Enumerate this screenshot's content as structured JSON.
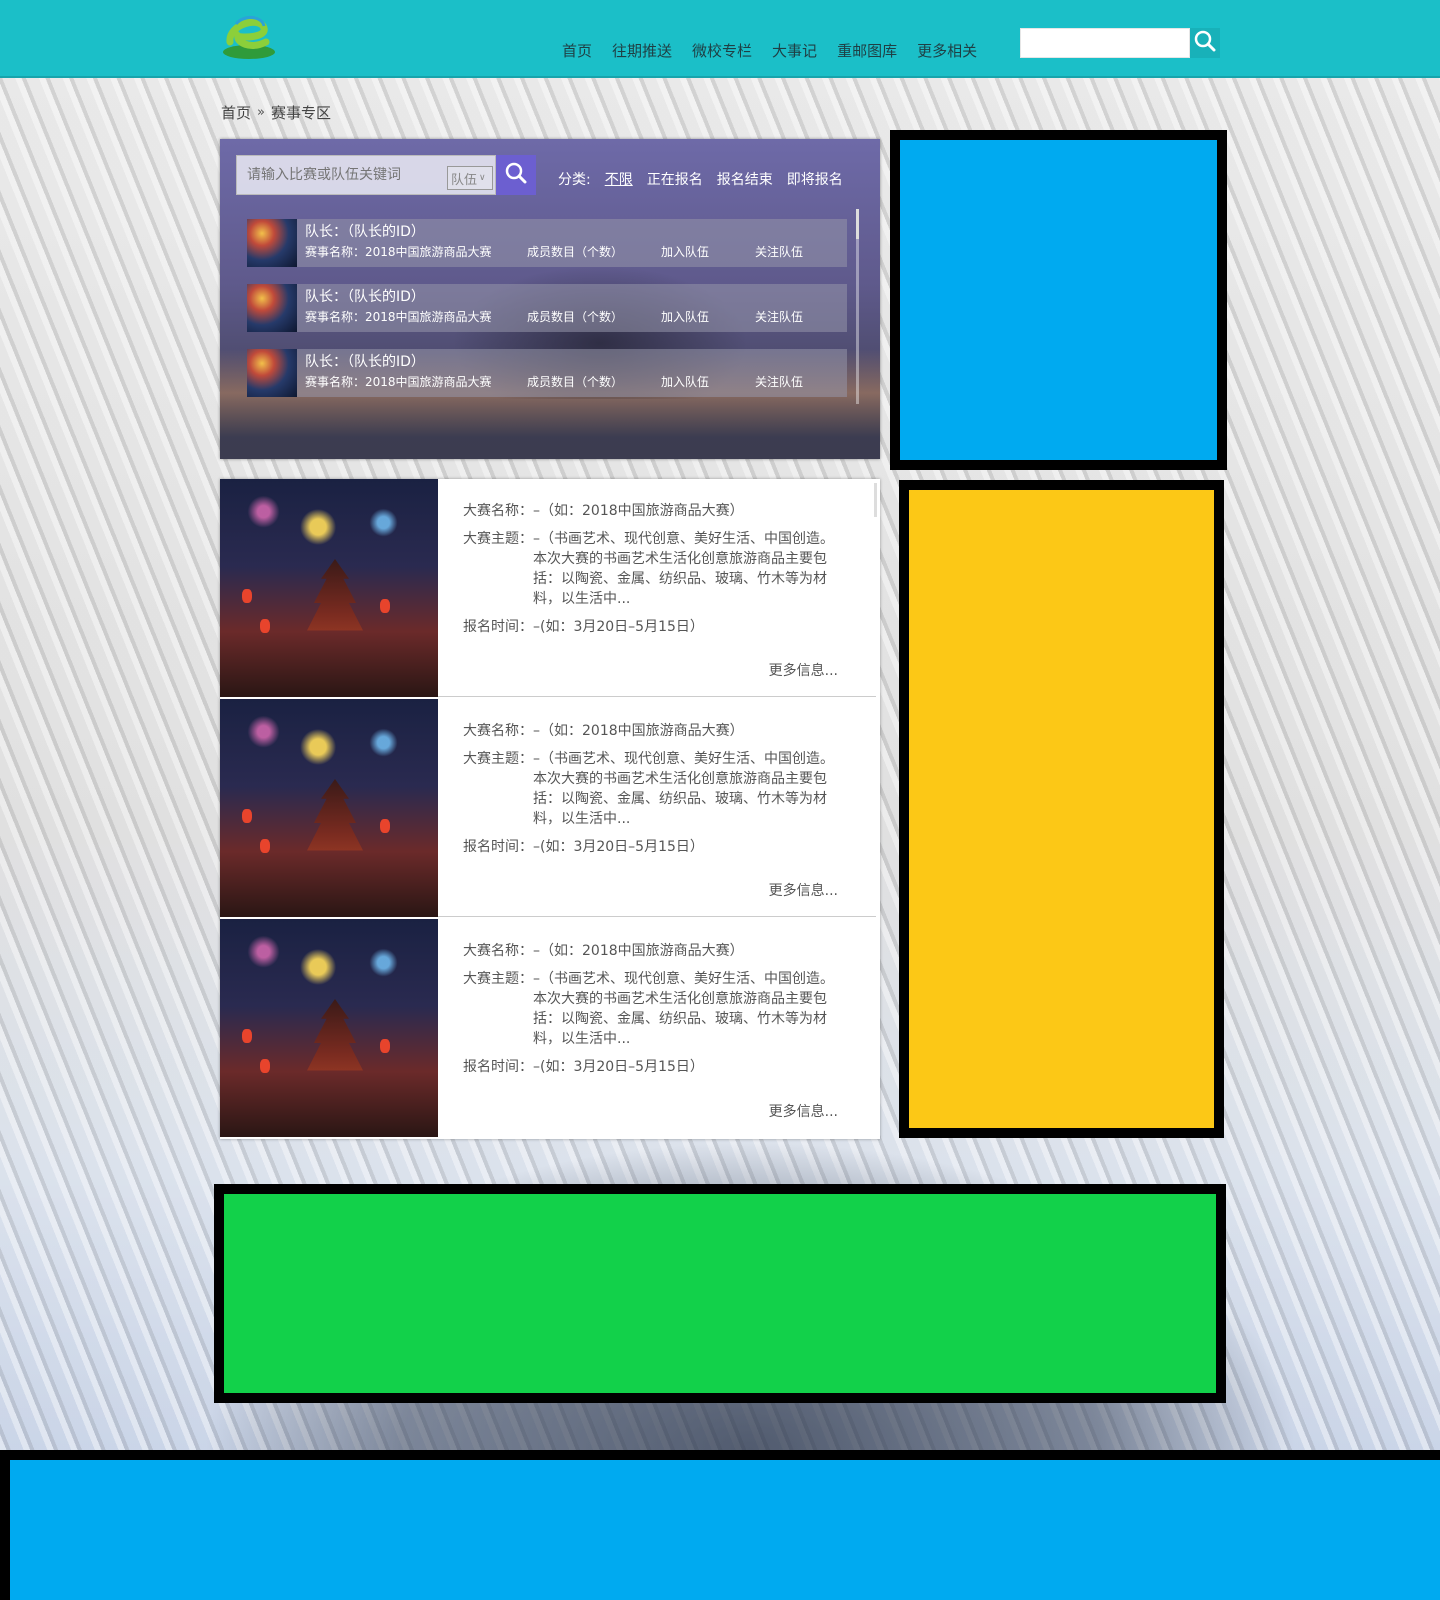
{
  "header": {
    "nav": [
      "首页",
      "往期推送",
      "微校专栏",
      "大事记",
      "重邮图库",
      "更多相关"
    ],
    "search_placeholder": ""
  },
  "breadcrumb": {
    "home": "首页",
    "separator": "»",
    "current": "赛事专区"
  },
  "team_panel": {
    "search_placeholder": "请输入比赛或队伍关键词",
    "select_value": "队伍",
    "filter_label": "分类:",
    "filters": [
      "不限",
      "正在报名",
      "报名结束",
      "即将报名"
    ],
    "active_filter": "不限",
    "teams": [
      {
        "captain": "队长：（队长的ID）",
        "contest": "赛事名称：2018中国旅游商品大赛",
        "members": "成员数目（个数）",
        "join": "加入队伍",
        "follow": "关注队伍"
      },
      {
        "captain": "队长：（队长的ID）",
        "contest": "赛事名称：2018中国旅游商品大赛",
        "members": "成员数目（个数）",
        "join": "加入队伍",
        "follow": "关注队伍"
      },
      {
        "captain": "队长：（队长的ID）",
        "contest": "赛事名称：2018中国旅游商品大赛",
        "members": "成员数目（个数）",
        "join": "加入队伍",
        "follow": "关注队伍"
      }
    ]
  },
  "contests": [
    {
      "name_label": "大赛名称：",
      "name": "–（如：2018中国旅游商品大赛）",
      "theme_label": "大赛主题：",
      "theme": "–（书画艺术、现代创意、美好生活、中国创造。本次大赛的书画艺术生活化创意旅游商品主要包括：以陶瓷、金属、纺织品、玻璃、竹木等为材料，以生活中...",
      "time_label": "报名时间：",
      "time": "–(如：3月20日–5月15日）",
      "more": "更多信息..."
    },
    {
      "name_label": "大赛名称：",
      "name": "–（如：2018中国旅游商品大赛）",
      "theme_label": "大赛主题：",
      "theme": "–（书画艺术、现代创意、美好生活、中国创造。本次大赛的书画艺术生活化创意旅游商品主要包括：以陶瓷、金属、纺织品、玻璃、竹木等为材料，以生活中...",
      "time_label": "报名时间：",
      "time": "–(如：3月20日–5月15日）",
      "more": "更多信息..."
    },
    {
      "name_label": "大赛名称：",
      "name": "–（如：2018中国旅游商品大赛）",
      "theme_label": "大赛主题：",
      "theme": "–（书画艺术、现代创意、美好生活、中国创造。本次大赛的书画艺术生活化创意旅游商品主要包括：以陶瓷、金属、纺织品、玻璃、竹木等为材料，以生活中...",
      "time_label": "报名时间：",
      "time": "–(如：3月20日–5月15日）",
      "more": "更多信息..."
    }
  ],
  "colors": {
    "header": "#1bbfc8",
    "block_blue": "#00aaf0",
    "block_yellow": "#fcc816",
    "block_green": "#12d14a",
    "search_button": "#6c5fd0"
  }
}
